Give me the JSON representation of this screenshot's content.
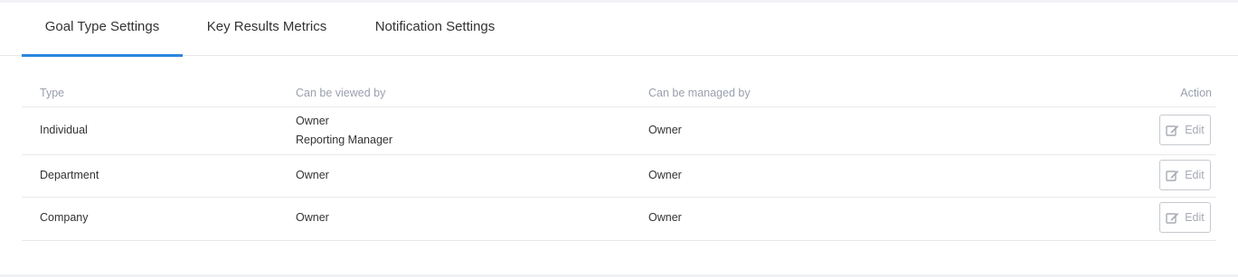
{
  "tabs": [
    {
      "label": "Goal Type Settings",
      "active": true
    },
    {
      "label": "Key Results Metrics",
      "active": false
    },
    {
      "label": "Notification Settings",
      "active": false
    }
  ],
  "table": {
    "headers": {
      "type": "Type",
      "viewed_by": "Can be viewed by",
      "managed_by": "Can be managed by",
      "action": "Action"
    },
    "rows": [
      {
        "type": "Individual",
        "viewed_by": [
          "Owner",
          "Reporting Manager"
        ],
        "managed_by": "Owner",
        "action_label": "Edit"
      },
      {
        "type": "Department",
        "viewed_by": [
          "Owner"
        ],
        "managed_by": "Owner",
        "action_label": "Edit"
      },
      {
        "type": "Company",
        "viewed_by": [
          "Owner"
        ],
        "managed_by": "Owner",
        "action_label": "Edit"
      }
    ]
  },
  "colors": {
    "accent": "#2d86e0",
    "header_text": "#9aa0ad",
    "border": "#e8e9ed"
  },
  "icons": {
    "edit": "edit-icon"
  }
}
